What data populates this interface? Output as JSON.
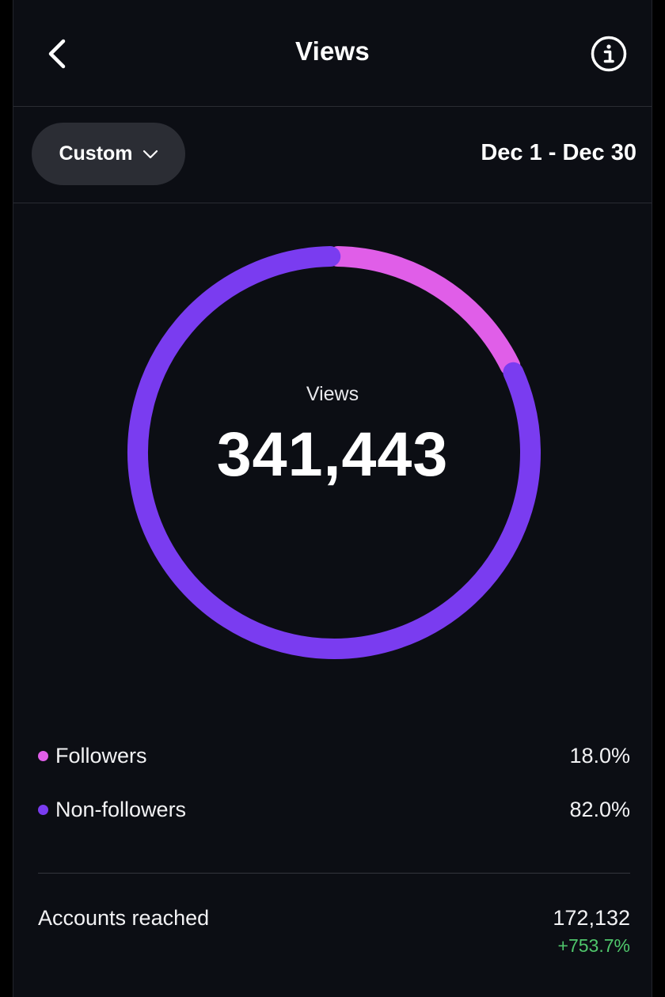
{
  "header": {
    "title": "Views",
    "back_icon": "chevron-left-icon",
    "info_icon": "info-icon"
  },
  "filter": {
    "range_label": "Custom",
    "dropdown_icon": "chevron-down-icon",
    "date_range": "Dec 1 - Dec 30"
  },
  "summary": {
    "center_label": "Views",
    "total": "341,443"
  },
  "chart_data": {
    "type": "pie",
    "title": "",
    "categories": [
      "Followers",
      "Non-followers"
    ],
    "values": [
      18.0,
      82.0
    ],
    "colors": [
      "#e05ee8",
      "#7a3cf0"
    ],
    "legend": "below"
  },
  "legend": [
    {
      "name": "Followers",
      "value": "18.0%",
      "color": "#e05ee8"
    },
    {
      "name": "Non-followers",
      "value": "82.0%",
      "color": "#7a3cf0"
    }
  ],
  "accounts_reached": {
    "label": "Accounts reached",
    "value": "172,132",
    "change": "+753.7%",
    "change_color": "#4fc66b"
  }
}
